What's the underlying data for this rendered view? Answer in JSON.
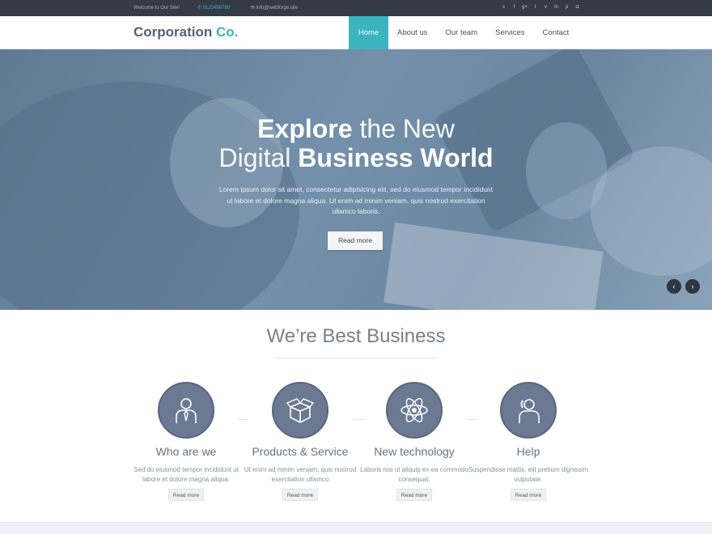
{
  "topbar": {
    "welcome": "Welcome to Our Site!",
    "phone": "0123456789",
    "email": "info@webforge.site",
    "socials": [
      "skype-icon",
      "facebook-icon",
      "google-plus-icon",
      "twitter-icon",
      "vimeo-icon",
      "linkedin-icon",
      "pinterest-icon",
      "instagram-icon"
    ]
  },
  "brand": {
    "name": "Corporation",
    "suffix": "Co."
  },
  "nav": {
    "items": [
      {
        "label": "Home",
        "active": true
      },
      {
        "label": "About us"
      },
      {
        "label": "Our team"
      },
      {
        "label": "Services"
      },
      {
        "label": "Contact"
      }
    ]
  },
  "hero": {
    "title_line1_bold": "Explore",
    "title_line1_thin": " the New",
    "title_line2_thin": "Digital ",
    "title_line2_bold": "Business World",
    "paragraph": "Lorem ipsum dolor sit amet, consectetur adipisicing elit, sed do eiusmod tempor incididunt ut labore et dolore magna aliqua. Ut enim ad minim veniam, quis nostrud exercitation ullamco laboris.",
    "button": "Read more",
    "prev": "‹",
    "next": "›"
  },
  "section": {
    "heading": "We’re Best Business",
    "features": [
      {
        "title": "Who are we",
        "desc": "Sed do eiusmod tempor incididunt ut labore et dolore magna aliqua.",
        "button": "Read more",
        "icon": "person-tie-icon"
      },
      {
        "title": "Products & Service",
        "desc": "Ut enim ad minim veniam, quis nostrud exercitation ullamco",
        "button": "Read more",
        "icon": "box-icon"
      },
      {
        "title": "New technology",
        "desc": "Laboris nisi ut aliquip ex ea commodo consequat.",
        "button": "Read more",
        "icon": "atom-icon"
      },
      {
        "title": "Help",
        "desc": "Suspendisse mattis, elit pretium dignissim vulputate.",
        "button": "Read more",
        "icon": "support-person-icon"
      }
    ]
  },
  "colors": {
    "accent": "#3bb4bf",
    "topbar": "#343b47",
    "icon_circle": "#6c7993"
  }
}
